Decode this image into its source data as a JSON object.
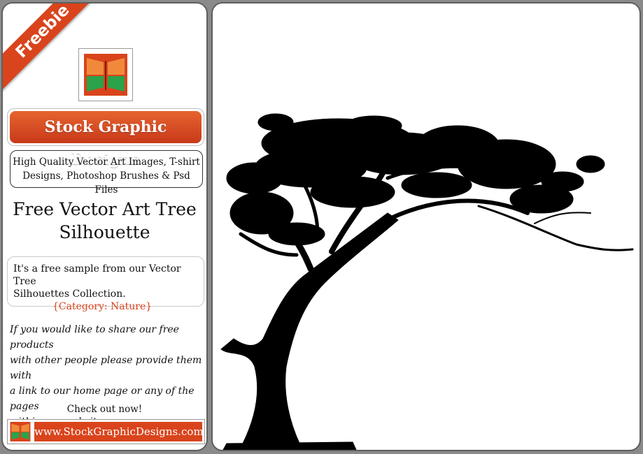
{
  "ribbon": "Freebie",
  "brand": "Stock Graphic Designs",
  "description_lines": [
    "High Quality Vector Art Images, T-shirt",
    "Designs, Photoshop Brushes & Psd Files"
  ],
  "title_lines": [
    "Free Vector Art Tree",
    "Silhouette"
  ],
  "info": {
    "lines": [
      "It's a free sample from our Vector Tree",
      "Silhouettes Collection."
    ],
    "category": "{Category: Nature}"
  },
  "share_lines": [
    "If you would like to share our free products",
    "with other people please provide them with",
    "a link to our home page or any of the pages",
    "within our website."
  ],
  "check_out": "Check out now!",
  "url": "www.StockGraphicDesigns.com",
  "colors": {
    "accent": "#d9441c",
    "logo_green": "#2aa34a",
    "frame": "#8a8a8a"
  },
  "icons": [
    "logo-icon",
    "tree-silhouette"
  ]
}
